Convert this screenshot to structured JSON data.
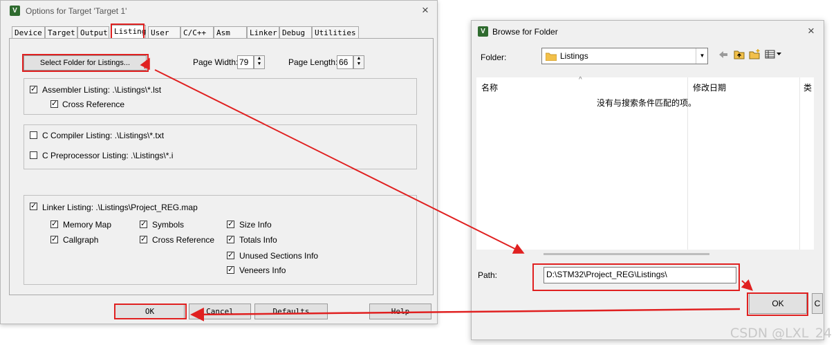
{
  "options": {
    "icon": "V",
    "title": "Options for Target 'Target 1'",
    "close": "×",
    "tabs": [
      "Device",
      "Target",
      "Output",
      "Listing",
      "User",
      "C/C++",
      "Asm",
      "Linker",
      "Debug",
      "Utilities"
    ],
    "active_tab": "Listing",
    "select_folder_button": "Select Folder for Listings...",
    "page_width_label": "Page Width:",
    "page_width": "79",
    "page_length_label": "Page Length:",
    "page_length": "66",
    "assembler": {
      "label": "Assembler Listing:  .\\Listings\\*.lst",
      "checked": true
    },
    "cross_reference": {
      "label": "Cross Reference",
      "checked": true
    },
    "c_compiler": {
      "label": "C Compiler Listing:  .\\Listings\\*.txt",
      "checked": false
    },
    "c_preprocessor": {
      "label": "C Preprocessor Listing:  .\\Listings\\*.i",
      "checked": false
    },
    "linker": {
      "label": "Linker Listing:  .\\Listings\\Project_REG.map",
      "checked": true
    },
    "linker_options": [
      {
        "label": "Memory Map",
        "checked": true
      },
      {
        "label": "Callgraph",
        "checked": true
      },
      {
        "label": "Symbols",
        "checked": true
      },
      {
        "label": "Cross Reference",
        "checked": true
      },
      {
        "label": "Size Info",
        "checked": true
      },
      {
        "label": "Totals Info",
        "checked": true
      },
      {
        "label": "Unused Sections Info",
        "checked": true
      },
      {
        "label": "Veneers Info",
        "checked": true
      }
    ],
    "buttons": {
      "ok": "OK",
      "cancel": "Cancel",
      "defaults": "Defaults",
      "help": "Help"
    }
  },
  "browse": {
    "icon": "V",
    "title": "Browse for Folder",
    "close": "×",
    "folder_label": "Folder:",
    "folder_value": "Listings",
    "toolbar_icons": [
      "back-arrow-icon",
      "up-folder-icon",
      "new-folder-icon",
      "view-menu-icon"
    ],
    "columns": [
      "名称",
      "修改日期",
      "类"
    ],
    "empty_message": "没有与搜索条件匹配的项。",
    "path_label": "Path:",
    "path_value": "D:\\STM32\\Project_REG\\Listings\\",
    "ok": "OK",
    "close_partial": "C"
  },
  "annotation_color": "#e02020",
  "watermark": "CSDN @LXL_24"
}
